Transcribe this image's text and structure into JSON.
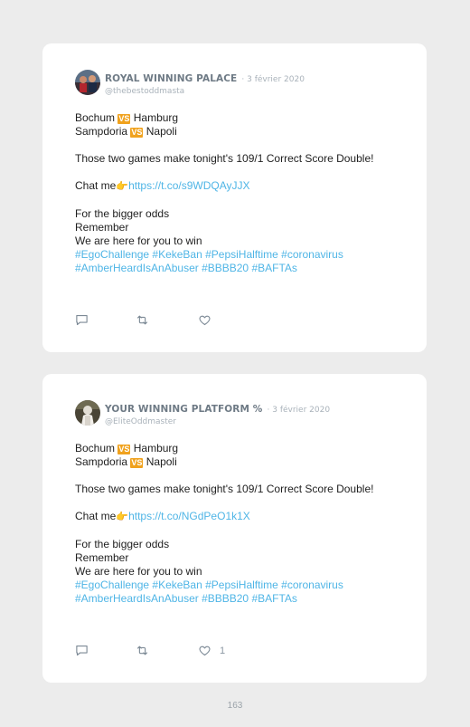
{
  "tweets": [
    {
      "name": "ROYAL WINNING PALACE",
      "date": "· 3 février 2020",
      "handle": "@thebestoddmasta",
      "match1_a": "Bochum",
      "match1_b": "Hamburg",
      "match2_a": "Sampdoria",
      "match2_b": "Napoli",
      "vs": "VS",
      "text1": "Those two games make tonight's 109/1 Correct Score Double!",
      "chat": "Chat me",
      "hand": "👉",
      "link": "https://t.co/s9WDQAyJJX",
      "line_a": "For the bigger odds",
      "line_b": "Remember",
      "line_c": "We are here for you to win",
      "tags1": "#EgoChallenge #KekeBan #PepsiHalftime #coronavirus",
      "tags2": "#AmberHeardIsAnAbuser #BBBB20 #BAFTAs",
      "like_count": ""
    },
    {
      "name": "YOUR WINNING PLATFORM %",
      "date": "· 3 février 2020",
      "handle": "@EliteOddmaster",
      "match1_a": "Bochum",
      "match1_b": "Hamburg",
      "match2_a": "Sampdoria",
      "match2_b": "Napoli",
      "vs": "VS",
      "text1": "Those two games make tonight's 109/1 Correct Score Double!",
      "chat": "Chat me",
      "hand": "👉",
      "link": "https://t.co/NGdPeO1k1X",
      "line_a": "For the bigger odds",
      "line_b": "Remember",
      "line_c": "We are here for you to win",
      "tags1": "#EgoChallenge #KekeBan #PepsiHalftime #coronavirus",
      "tags2": "#AmberHeardIsAnAbuser #BBBB20 #BAFTAs",
      "like_count": "1"
    }
  ],
  "page_number": "163",
  "colors": {
    "name": "#6e7a85",
    "meta": "#a9b2ba",
    "link": "#4fb5e6",
    "vs_badge": "#f0a21e",
    "icon": "#7d8a96"
  },
  "icons": [
    "reply-icon",
    "retweet-icon",
    "like-icon"
  ]
}
